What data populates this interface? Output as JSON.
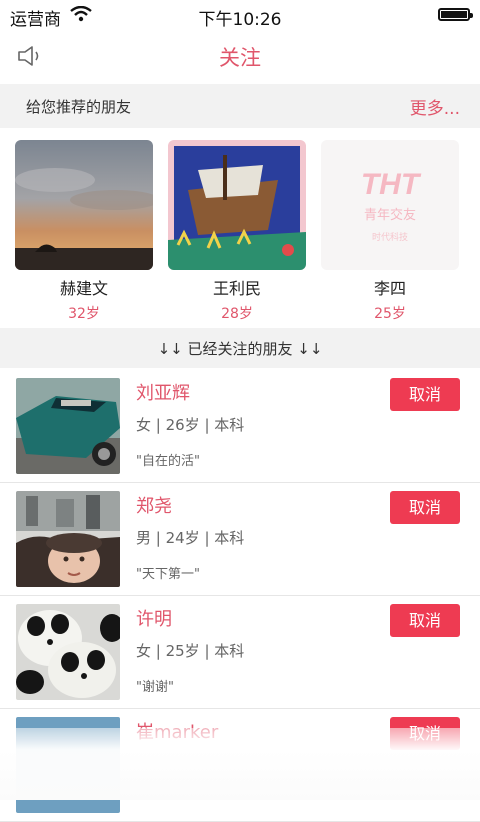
{
  "status_bar": {
    "carrier": "运营商",
    "time": "下午10:26"
  },
  "nav": {
    "title": "关注"
  },
  "recommend": {
    "title": "给您推荐的朋友",
    "more": "更多...",
    "people": [
      {
        "name": "赫建文",
        "age": "32岁"
      },
      {
        "name": "王利民",
        "age": "28岁"
      },
      {
        "name": "李四",
        "age": "25岁",
        "logo_text": "THT",
        "logo_sub": "青年交友",
        "logo_tagline": "时代科技"
      }
    ]
  },
  "followed": {
    "title": "↓↓  已经关注的朋友  ↓↓",
    "items": [
      {
        "name": "刘亚辉",
        "info": "女 | 26岁 | 本科",
        "signature": "\"自在的活\"",
        "action": "取消"
      },
      {
        "name": "郑尧",
        "info": "男 | 24岁 | 本科",
        "signature": "\"天下第一\"",
        "action": "取消"
      },
      {
        "name": "许明",
        "info": "女 | 25岁 | 本科",
        "signature": "\"谢谢\"",
        "action": "取消"
      },
      {
        "name": "崔marker",
        "action": "取消"
      }
    ]
  },
  "colors": {
    "accent": "#e0566b",
    "button": "#ee3b52"
  }
}
